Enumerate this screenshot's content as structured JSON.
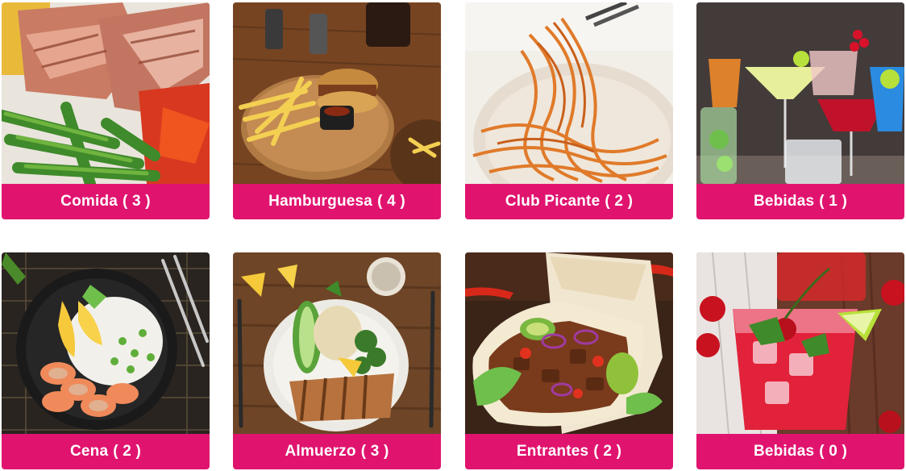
{
  "categories": [
    {
      "name": "Comida",
      "count_text": "( 3 )",
      "image": "grilled-meat-green-beans"
    },
    {
      "name": "Hamburguesa",
      "count_text": "( 4 )",
      "image": "burger-fries-board"
    },
    {
      "name": "Club Picante",
      "count_text": "( 2 )",
      "image": "spicy-noodles-bowl"
    },
    {
      "name": "Bebidas",
      "count_text": "( 1 )",
      "image": "cocktail-glasses"
    },
    {
      "name": "Cena",
      "count_text": "( 2 )",
      "image": "shrimp-rice-bowl"
    },
    {
      "name": "Almuerzo",
      "count_text": "( 3 )",
      "image": "chicken-quinoa-bowl"
    },
    {
      "name": "Entrantes",
      "count_text": "( 2 )",
      "image": "burrito-wrap"
    },
    {
      "name": "Bebidas",
      "count_text": "( 0 )",
      "image": "red-cherry-drink"
    }
  ],
  "colors": {
    "label_background": "#e0146f",
    "label_text": "#ffffff"
  }
}
